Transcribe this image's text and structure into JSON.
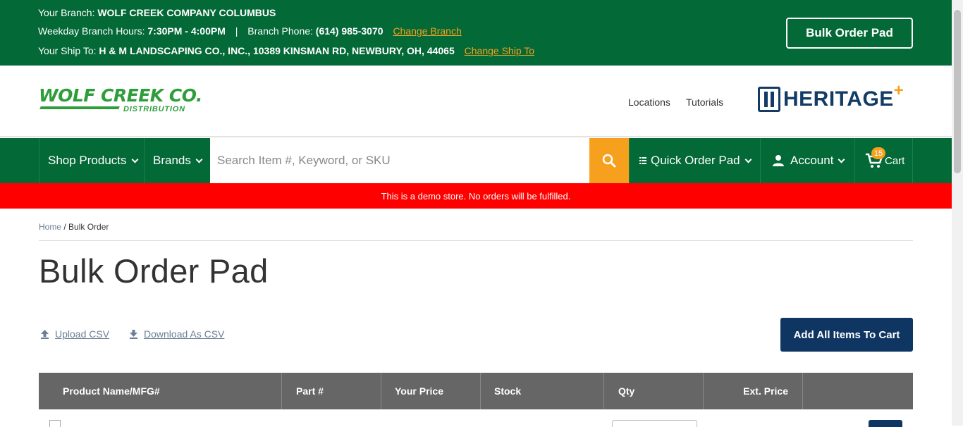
{
  "topbar": {
    "branch_label": "Your Branch:",
    "branch_name": "WOLF CREEK COMPANY COLUMBUS",
    "hours_label": "Weekday Branch Hours:",
    "hours_value": "7:30PM - 4:00PM",
    "separator": "|",
    "phone_label": "Branch Phone:",
    "phone_value": "(614) 985-3070",
    "change_branch": "Change Branch",
    "ship_label": "Your Ship To:",
    "ship_value": "H & M LANDSCAPING CO., INC., 10389 KINSMAN RD, NEWBURY, OH, 44065",
    "change_ship": "Change Ship To",
    "bulk_button": "Bulk Order Pad"
  },
  "header": {
    "logo_name": "WOLF CREEK CO.",
    "logo_sub": "DISTRIBUTION",
    "links": [
      "Locations",
      "Tutorials"
    ],
    "partner_logo": "HERITAGE",
    "partner_plus": "+"
  },
  "nav": {
    "shop": "Shop Products",
    "brands": "Brands",
    "search_placeholder": "Search Item #, Keyword, or SKU",
    "quick_order": "Quick Order Pad",
    "account": "Account",
    "cart": "Cart",
    "cart_count": "15"
  },
  "notice": "This is a demo store. No orders will be fulfilled.",
  "breadcrumb": {
    "home": "Home",
    "separator": "/",
    "current": "Bulk Order"
  },
  "page_title": "Bulk Order Pad",
  "actions": {
    "upload_csv": "Upload CSV",
    "download_csv": "Download As CSV",
    "add_all": "Add All Items To Cart"
  },
  "table": {
    "columns": [
      "Product Name/MFG#",
      "Part #",
      "Your Price",
      "Stock",
      "Qty",
      "Ext. Price"
    ]
  },
  "colors": {
    "brand_green": "#036937",
    "accent_orange": "#f7a01d",
    "navy": "#0f3663",
    "notice_red": "#ff0000"
  }
}
